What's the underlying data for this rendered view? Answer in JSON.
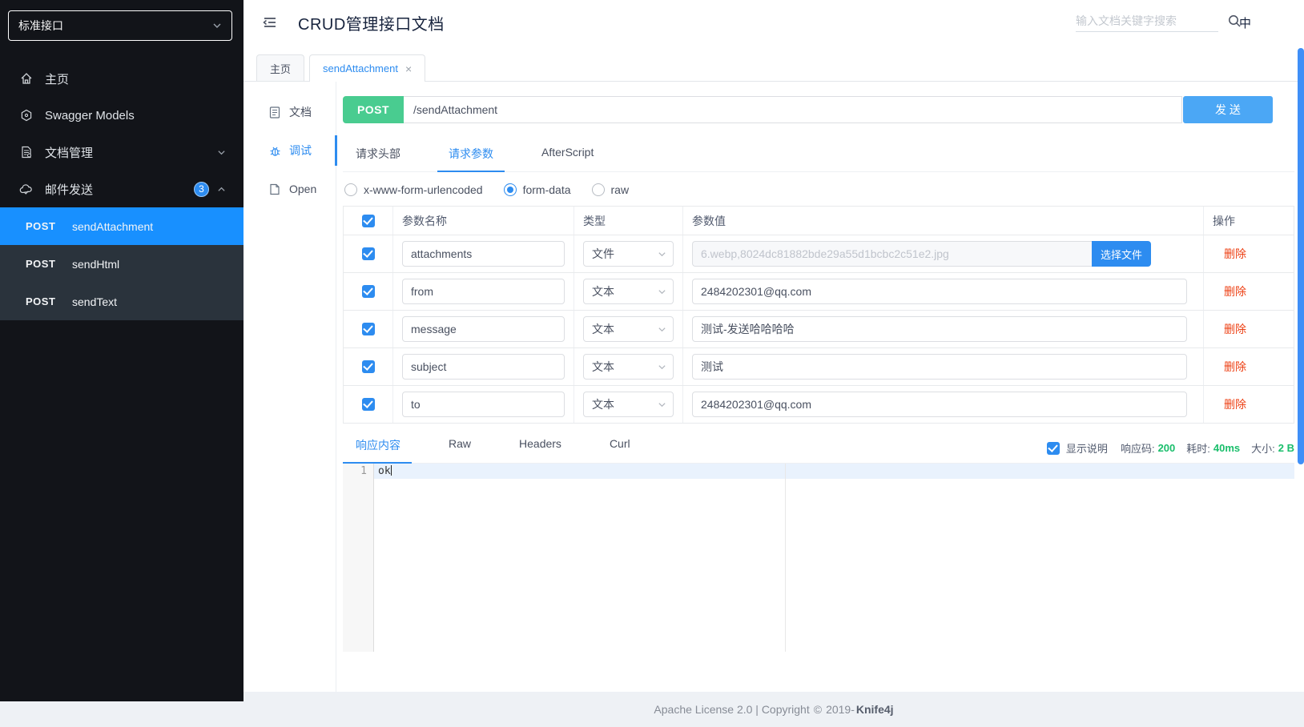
{
  "colors": {
    "accent_blue": "#2d8cf0",
    "active_item_blue": "#1890ff",
    "post_green": "#49cc90",
    "send_button_blue": "#4ba7f5",
    "delete_red": "#ed4014",
    "success_green": "#19be6b",
    "sidebar_dark": "#121419",
    "submenu_dark": "#2a333c"
  },
  "sidebar": {
    "group_select": "标准接口",
    "items": [
      {
        "label": "主页",
        "icon": "home-icon"
      },
      {
        "label": "Swagger Models",
        "icon": "swagger-models-icon"
      },
      {
        "label": "文档管理",
        "icon": "doc-manage-icon",
        "chevron": "down"
      },
      {
        "label": "邮件发送",
        "icon": "mail-send-icon",
        "badge": "3",
        "chevron": "up"
      }
    ],
    "sub_items": [
      {
        "method": "POST",
        "label": "sendAttachment",
        "active": true
      },
      {
        "method": "POST",
        "label": "sendHtml",
        "active": false
      },
      {
        "method": "POST",
        "label": "sendText",
        "active": false
      }
    ]
  },
  "header": {
    "title": "CRUD管理接口文档",
    "search_placeholder": "输入文档关键字搜索",
    "lang_toggle": "中"
  },
  "tabs": [
    {
      "label": "主页",
      "active": false
    },
    {
      "label": "sendAttachment",
      "active": true,
      "close": "×"
    }
  ],
  "doc_nav": [
    {
      "label": "文档",
      "icon": "document-icon",
      "active": false
    },
    {
      "label": "调试",
      "icon": "debug-icon",
      "active": true
    },
    {
      "label": "Open",
      "icon": "open-api-icon",
      "active": false
    }
  ],
  "request": {
    "method": "POST",
    "url": "/sendAttachment",
    "send_label": "发 送",
    "tabs": [
      {
        "label": "请求头部",
        "active": false
      },
      {
        "label": "请求参数",
        "active": true
      },
      {
        "label": "AfterScript",
        "active": false
      }
    ],
    "body_types": [
      {
        "label": "x-www-form-urlencoded",
        "checked": false
      },
      {
        "label": "form-data",
        "checked": true
      },
      {
        "label": "raw",
        "checked": false
      }
    ],
    "table": {
      "headers": {
        "name": "参数名称",
        "type": "类型",
        "value": "参数值",
        "action": "操作"
      },
      "rows": [
        {
          "name": "attachments",
          "type": "文件",
          "value": "6.webp,8024dc81882bde29a55d1bcbc2c51e2.jpg",
          "file_button": "选择文件",
          "action": "删除"
        },
        {
          "name": "from",
          "type": "文本",
          "value": "2484202301@qq.com",
          "action": "删除"
        },
        {
          "name": "message",
          "type": "文本",
          "value": "测试-发送哈哈哈哈",
          "action": "删除"
        },
        {
          "name": "subject",
          "type": "文本",
          "value": "测试",
          "action": "删除"
        },
        {
          "name": "to",
          "type": "文本",
          "value": "2484202301@qq.com",
          "action": "删除"
        }
      ]
    }
  },
  "response": {
    "tabs": [
      {
        "label": "响应内容",
        "active": true
      },
      {
        "label": "Raw",
        "active": false
      },
      {
        "label": "Headers",
        "active": false
      },
      {
        "label": "Curl",
        "active": false
      }
    ],
    "show_desc_label": "显示说明",
    "status": {
      "code_label": "响应码:",
      "code_value": "200",
      "time_label": "耗时:",
      "time_value": "40ms",
      "size_label": "大小:",
      "size_value": "2 B"
    },
    "editor": {
      "line_number": "1",
      "content": "ok"
    }
  },
  "footer": {
    "left_text": "Apache License 2.0 | Copyright",
    "copyright_symbol": "©",
    "year": "2019-",
    "brand": "Knife4j"
  }
}
